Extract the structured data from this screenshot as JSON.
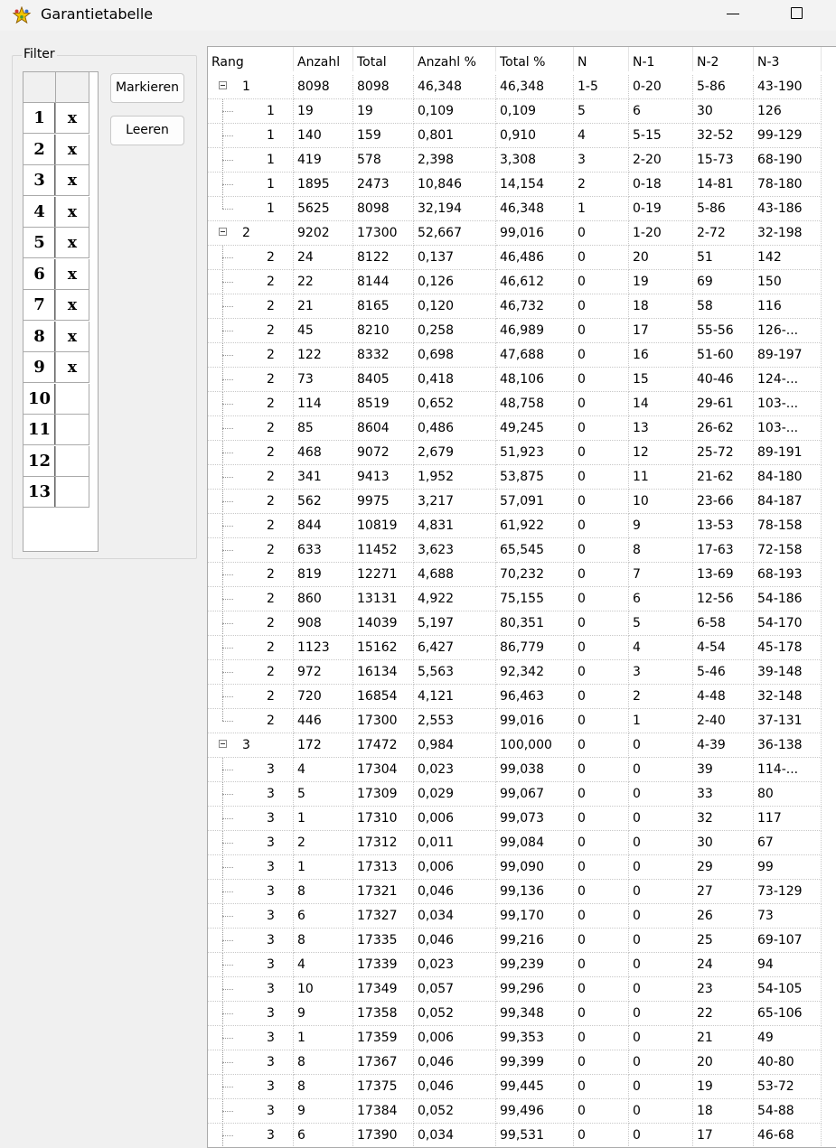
{
  "window": {
    "title": "Garantietabelle",
    "icon": "star-app-icon"
  },
  "filter": {
    "label": "Filter",
    "rows": [
      {
        "num": "1",
        "mark": "x"
      },
      {
        "num": "2",
        "mark": "x"
      },
      {
        "num": "3",
        "mark": "x"
      },
      {
        "num": "4",
        "mark": "x"
      },
      {
        "num": "5",
        "mark": "x"
      },
      {
        "num": "6",
        "mark": "x"
      },
      {
        "num": "7",
        "mark": "x"
      },
      {
        "num": "8",
        "mark": "x"
      },
      {
        "num": "9",
        "mark": "x"
      },
      {
        "num": "10",
        "mark": ""
      },
      {
        "num": "11",
        "mark": ""
      },
      {
        "num": "12",
        "mark": ""
      },
      {
        "num": "13",
        "mark": ""
      }
    ]
  },
  "buttons": {
    "mark": "Markieren",
    "clear": "Leeren"
  },
  "table": {
    "columns": [
      "Rang",
      "Anzahl",
      "Total",
      "Anzahl %",
      "Total %",
      "N",
      "N-1",
      "N-2",
      "N-3"
    ],
    "rows": [
      {
        "level": 0,
        "rang": "1",
        "anzahl": "8098",
        "total": "8098",
        "anzahl_pct": "46,348",
        "total_pct": "46,348",
        "n": "1-5",
        "n1": "0-20",
        "n2": "5-86",
        "n3": "43-190"
      },
      {
        "level": 1,
        "rang": "1",
        "anzahl": "19",
        "total": "19",
        "anzahl_pct": "0,109",
        "total_pct": "0,109",
        "n": "5",
        "n1": "6",
        "n2": "30",
        "n3": "126"
      },
      {
        "level": 1,
        "rang": "1",
        "anzahl": "140",
        "total": "159",
        "anzahl_pct": "0,801",
        "total_pct": "0,910",
        "n": "4",
        "n1": "5-15",
        "n2": "32-52",
        "n3": "99-129"
      },
      {
        "level": 1,
        "rang": "1",
        "anzahl": "419",
        "total": "578",
        "anzahl_pct": "2,398",
        "total_pct": "3,308",
        "n": "3",
        "n1": "2-20",
        "n2": "15-73",
        "n3": "68-190"
      },
      {
        "level": 1,
        "rang": "1",
        "anzahl": "1895",
        "total": "2473",
        "anzahl_pct": "10,846",
        "total_pct": "14,154",
        "n": "2",
        "n1": "0-18",
        "n2": "14-81",
        "n3": "78-180"
      },
      {
        "level": 1,
        "rang": "1",
        "anzahl": "5625",
        "total": "8098",
        "anzahl_pct": "32,194",
        "total_pct": "46,348",
        "n": "1",
        "n1": "0-19",
        "n2": "5-86",
        "n3": "43-186",
        "last": true
      },
      {
        "level": 0,
        "rang": "2",
        "anzahl": "9202",
        "total": "17300",
        "anzahl_pct": "52,667",
        "total_pct": "99,016",
        "n": "0",
        "n1": "1-20",
        "n2": "2-72",
        "n3": "32-198"
      },
      {
        "level": 1,
        "rang": "2",
        "anzahl": "24",
        "total": "8122",
        "anzahl_pct": "0,137",
        "total_pct": "46,486",
        "n": "0",
        "n1": "20",
        "n2": "51",
        "n3": "142"
      },
      {
        "level": 1,
        "rang": "2",
        "anzahl": "22",
        "total": "8144",
        "anzahl_pct": "0,126",
        "total_pct": "46,612",
        "n": "0",
        "n1": "19",
        "n2": "69",
        "n3": "150"
      },
      {
        "level": 1,
        "rang": "2",
        "anzahl": "21",
        "total": "8165",
        "anzahl_pct": "0,120",
        "total_pct": "46,732",
        "n": "0",
        "n1": "18",
        "n2": "58",
        "n3": "116"
      },
      {
        "level": 1,
        "rang": "2",
        "anzahl": "45",
        "total": "8210",
        "anzahl_pct": "0,258",
        "total_pct": "46,989",
        "n": "0",
        "n1": "17",
        "n2": "55-56",
        "n3": "126-..."
      },
      {
        "level": 1,
        "rang": "2",
        "anzahl": "122",
        "total": "8332",
        "anzahl_pct": "0,698",
        "total_pct": "47,688",
        "n": "0",
        "n1": "16",
        "n2": "51-60",
        "n3": "89-197"
      },
      {
        "level": 1,
        "rang": "2",
        "anzahl": "73",
        "total": "8405",
        "anzahl_pct": "0,418",
        "total_pct": "48,106",
        "n": "0",
        "n1": "15",
        "n2": "40-46",
        "n3": "124-..."
      },
      {
        "level": 1,
        "rang": "2",
        "anzahl": "114",
        "total": "8519",
        "anzahl_pct": "0,652",
        "total_pct": "48,758",
        "n": "0",
        "n1": "14",
        "n2": "29-61",
        "n3": "103-..."
      },
      {
        "level": 1,
        "rang": "2",
        "anzahl": "85",
        "total": "8604",
        "anzahl_pct": "0,486",
        "total_pct": "49,245",
        "n": "0",
        "n1": "13",
        "n2": "26-62",
        "n3": "103-..."
      },
      {
        "level": 1,
        "rang": "2",
        "anzahl": "468",
        "total": "9072",
        "anzahl_pct": "2,679",
        "total_pct": "51,923",
        "n": "0",
        "n1": "12",
        "n2": "25-72",
        "n3": "89-191"
      },
      {
        "level": 1,
        "rang": "2",
        "anzahl": "341",
        "total": "9413",
        "anzahl_pct": "1,952",
        "total_pct": "53,875",
        "n": "0",
        "n1": "11",
        "n2": "21-62",
        "n3": "84-180"
      },
      {
        "level": 1,
        "rang": "2",
        "anzahl": "562",
        "total": "9975",
        "anzahl_pct": "3,217",
        "total_pct": "57,091",
        "n": "0",
        "n1": "10",
        "n2": "23-66",
        "n3": "84-187"
      },
      {
        "level": 1,
        "rang": "2",
        "anzahl": "844",
        "total": "10819",
        "anzahl_pct": "4,831",
        "total_pct": "61,922",
        "n": "0",
        "n1": "9",
        "n2": "13-53",
        "n3": "78-158"
      },
      {
        "level": 1,
        "rang": "2",
        "anzahl": "633",
        "total": "11452",
        "anzahl_pct": "3,623",
        "total_pct": "65,545",
        "n": "0",
        "n1": "8",
        "n2": "17-63",
        "n3": "72-158"
      },
      {
        "level": 1,
        "rang": "2",
        "anzahl": "819",
        "total": "12271",
        "anzahl_pct": "4,688",
        "total_pct": "70,232",
        "n": "0",
        "n1": "7",
        "n2": "13-69",
        "n3": "68-193"
      },
      {
        "level": 1,
        "rang": "2",
        "anzahl": "860",
        "total": "13131",
        "anzahl_pct": "4,922",
        "total_pct": "75,155",
        "n": "0",
        "n1": "6",
        "n2": "12-56",
        "n3": "54-186"
      },
      {
        "level": 1,
        "rang": "2",
        "anzahl": "908",
        "total": "14039",
        "anzahl_pct": "5,197",
        "total_pct": "80,351",
        "n": "0",
        "n1": "5",
        "n2": "6-58",
        "n3": "54-170"
      },
      {
        "level": 1,
        "rang": "2",
        "anzahl": "1123",
        "total": "15162",
        "anzahl_pct": "6,427",
        "total_pct": "86,779",
        "n": "0",
        "n1": "4",
        "n2": "4-54",
        "n3": "45-178"
      },
      {
        "level": 1,
        "rang": "2",
        "anzahl": "972",
        "total": "16134",
        "anzahl_pct": "5,563",
        "total_pct": "92,342",
        "n": "0",
        "n1": "3",
        "n2": "5-46",
        "n3": "39-148"
      },
      {
        "level": 1,
        "rang": "2",
        "anzahl": "720",
        "total": "16854",
        "anzahl_pct": "4,121",
        "total_pct": "96,463",
        "n": "0",
        "n1": "2",
        "n2": "4-48",
        "n3": "32-148"
      },
      {
        "level": 1,
        "rang": "2",
        "anzahl": "446",
        "total": "17300",
        "anzahl_pct": "2,553",
        "total_pct": "99,016",
        "n": "0",
        "n1": "1",
        "n2": "2-40",
        "n3": "37-131",
        "last": true
      },
      {
        "level": 0,
        "rang": "3",
        "anzahl": "172",
        "total": "17472",
        "anzahl_pct": "0,984",
        "total_pct": "100,000",
        "n": "0",
        "n1": "0",
        "n2": "4-39",
        "n3": "36-138"
      },
      {
        "level": 1,
        "rang": "3",
        "anzahl": "4",
        "total": "17304",
        "anzahl_pct": "0,023",
        "total_pct": "99,038",
        "n": "0",
        "n1": "0",
        "n2": "39",
        "n3": "114-..."
      },
      {
        "level": 1,
        "rang": "3",
        "anzahl": "5",
        "total": "17309",
        "anzahl_pct": "0,029",
        "total_pct": "99,067",
        "n": "0",
        "n1": "0",
        "n2": "33",
        "n3": "80"
      },
      {
        "level": 1,
        "rang": "3",
        "anzahl": "1",
        "total": "17310",
        "anzahl_pct": "0,006",
        "total_pct": "99,073",
        "n": "0",
        "n1": "0",
        "n2": "32",
        "n3": "117"
      },
      {
        "level": 1,
        "rang": "3",
        "anzahl": "2",
        "total": "17312",
        "anzahl_pct": "0,011",
        "total_pct": "99,084",
        "n": "0",
        "n1": "0",
        "n2": "30",
        "n3": "67"
      },
      {
        "level": 1,
        "rang": "3",
        "anzahl": "1",
        "total": "17313",
        "anzahl_pct": "0,006",
        "total_pct": "99,090",
        "n": "0",
        "n1": "0",
        "n2": "29",
        "n3": "99"
      },
      {
        "level": 1,
        "rang": "3",
        "anzahl": "8",
        "total": "17321",
        "anzahl_pct": "0,046",
        "total_pct": "99,136",
        "n": "0",
        "n1": "0",
        "n2": "27",
        "n3": "73-129"
      },
      {
        "level": 1,
        "rang": "3",
        "anzahl": "6",
        "total": "17327",
        "anzahl_pct": "0,034",
        "total_pct": "99,170",
        "n": "0",
        "n1": "0",
        "n2": "26",
        "n3": "73"
      },
      {
        "level": 1,
        "rang": "3",
        "anzahl": "8",
        "total": "17335",
        "anzahl_pct": "0,046",
        "total_pct": "99,216",
        "n": "0",
        "n1": "0",
        "n2": "25",
        "n3": "69-107"
      },
      {
        "level": 1,
        "rang": "3",
        "anzahl": "4",
        "total": "17339",
        "anzahl_pct": "0,023",
        "total_pct": "99,239",
        "n": "0",
        "n1": "0",
        "n2": "24",
        "n3": "94"
      },
      {
        "level": 1,
        "rang": "3",
        "anzahl": "10",
        "total": "17349",
        "anzahl_pct": "0,057",
        "total_pct": "99,296",
        "n": "0",
        "n1": "0",
        "n2": "23",
        "n3": "54-105"
      },
      {
        "level": 1,
        "rang": "3",
        "anzahl": "9",
        "total": "17358",
        "anzahl_pct": "0,052",
        "total_pct": "99,348",
        "n": "0",
        "n1": "0",
        "n2": "22",
        "n3": "65-106"
      },
      {
        "level": 1,
        "rang": "3",
        "anzahl": "1",
        "total": "17359",
        "anzahl_pct": "0,006",
        "total_pct": "99,353",
        "n": "0",
        "n1": "0",
        "n2": "21",
        "n3": "49"
      },
      {
        "level": 1,
        "rang": "3",
        "anzahl": "8",
        "total": "17367",
        "anzahl_pct": "0,046",
        "total_pct": "99,399",
        "n": "0",
        "n1": "0",
        "n2": "20",
        "n3": "40-80"
      },
      {
        "level": 1,
        "rang": "3",
        "anzahl": "8",
        "total": "17375",
        "anzahl_pct": "0,046",
        "total_pct": "99,445",
        "n": "0",
        "n1": "0",
        "n2": "19",
        "n3": "53-72"
      },
      {
        "level": 1,
        "rang": "3",
        "anzahl": "9",
        "total": "17384",
        "anzahl_pct": "0,052",
        "total_pct": "99,496",
        "n": "0",
        "n1": "0",
        "n2": "18",
        "n3": "54-88"
      },
      {
        "level": 1,
        "rang": "3",
        "anzahl": "6",
        "total": "17390",
        "anzahl_pct": "0,034",
        "total_pct": "99,531",
        "n": "0",
        "n1": "0",
        "n2": "17",
        "n3": "46-68"
      }
    ]
  }
}
